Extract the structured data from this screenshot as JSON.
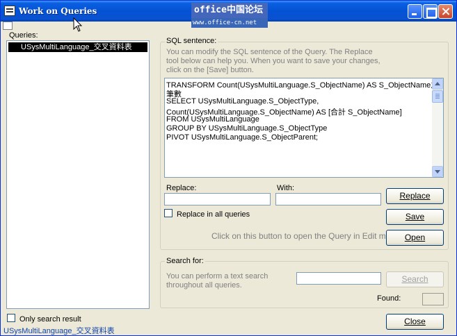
{
  "window": {
    "title": "Work on Queries",
    "watermark_top": "office中国论坛",
    "watermark_bottom": "www.office-cn.net"
  },
  "queries": {
    "label": "Queries:",
    "items": [
      "USysMultiLanguage_交叉資料表"
    ]
  },
  "sql": {
    "group_label": "SQL sentence:",
    "hint_lines": [
      "You can modify the SQL sentence of the Query. The Replace",
      "tool below can help you. When you want to save your changes,",
      "click on the [Save] button."
    ],
    "lines": [
      "TRANSFORM Count(USysMultiLanguage.S_ObjectName) AS S_ObjectName之",
      "筆數",
      "SELECT USysMultiLanguage.S_ObjectType,",
      "Count(USysMultiLanguage.S_ObjectName) AS [合計 S_ObjectName]",
      "FROM USysMultiLanguage",
      "GROUP BY USysMultiLanguage.S_ObjectType",
      "PIVOT USysMultiLanguage.S_ObjectParent;"
    ],
    "replace_label": "Replace:",
    "replace_value": "",
    "with_label": "With:",
    "with_value": "",
    "replace_all_label": "Replace in all queries",
    "replace_all_checked": false,
    "edit_hint": "Click on this button to open the Query in Edit mode.",
    "replace_button": "Replace",
    "save_button": "Save",
    "open_button": "Open"
  },
  "search": {
    "group_label": "Search for:",
    "hint_lines": [
      "You can perform a text search",
      "throughout all queries."
    ],
    "value": "",
    "button": "Search",
    "found_label": "Found:",
    "found_value": ""
  },
  "footer": {
    "only_search_label": "Only search result",
    "only_search_checked": false,
    "status_text": "USysMultiLanguage_交叉資料表",
    "close_button": "Close"
  }
}
